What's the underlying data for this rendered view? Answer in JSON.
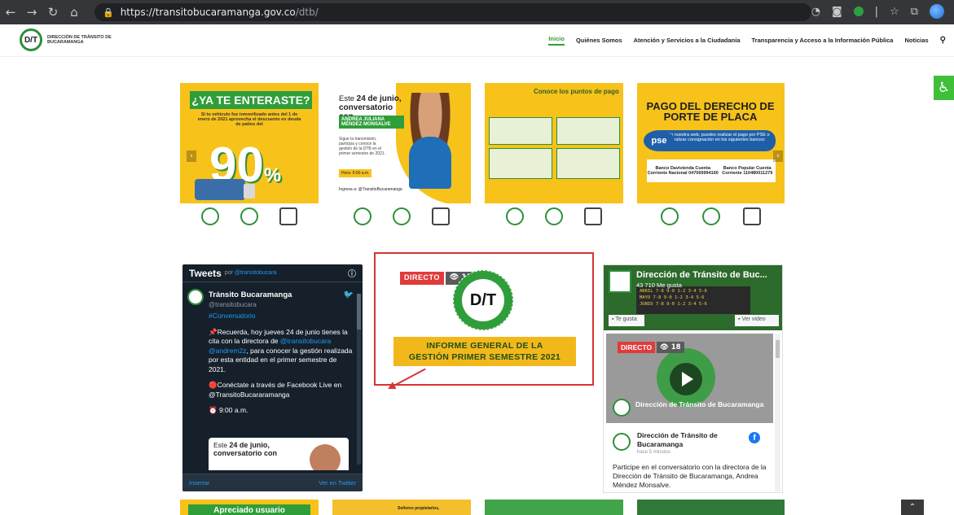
{
  "browser": {
    "url_host": "https://transitobucaramanga.gov.co",
    "url_path": "/dtb/"
  },
  "site": {
    "logo_text": "DIRECCIÓN DE TRÁNSITO DE BUCARAMANGA",
    "logo_mark": "D/T",
    "menu": [
      {
        "label": "Inicio",
        "active": true
      },
      {
        "label": "Quiénes Somos"
      },
      {
        "label": "Atención y Servicios a la Ciudadanía"
      },
      {
        "label": "Transparencia y Acceso a la Información Pública"
      },
      {
        "label": "Noticias"
      }
    ]
  },
  "carousel": {
    "card1": {
      "title": "¿YA TE ENTERASTE?",
      "subtitle": "Si tu vehículo fue inmovilizado antes del 1 de enero de 2021 aprovecha el descuento en deuda de patios del",
      "percent": "90",
      "percent_sign": "%"
    },
    "card2": {
      "intro": "Este",
      "date": "24 de junio,",
      "headline": "conversatorio con",
      "name": "ANDREA JULIANA MÉNDEZ MONSALVE",
      "small": "Sigue la transmisión, participa y conoce la gestión de la DTB en el primer semestre de 2021.",
      "hora": "Hora: 9:00 a.m.",
      "fb": "Ingresa a: @TransitoBucaramanga"
    },
    "card3": {
      "title": "Conoce los puntos de pago"
    },
    "card4": {
      "title": "PAGO DEL DERECHO DE PORTE DE PLACA",
      "pse": "pse",
      "pse_text": "En nuestra web, puedes realizar el pago por PSE o realizar consignación en los siguientes bancos:",
      "bank1": "Banco Davivienda Cuenta Corriente Nacional 047069994160",
      "bank2": "Banco Popular Cuenta Corriente 110480011279"
    }
  },
  "twitter": {
    "header": "Tweets",
    "by": "por",
    "handle": "@transitobucara",
    "account_name": "Tránsito Bucaramanga",
    "account_handle": "@transitobucara",
    "hashtag": "#Conversatorio",
    "p1_a": "📌Recuerda, hoy jueves 24 de junio tienes la cita con la directora de ",
    "p1_link1": "@transitobucara",
    "p1_link2": "@andrem2z",
    "p1_b": ", para conocer la gestión realizada por esta entidad en el primer semestre de 2021.",
    "p2": "🔴Conéctate a través de Facebook Live en @TransitoBucararamanga",
    "p3": "⏰ 9:00 a.m.",
    "embed_a": "Este",
    "embed_b": "24 de junio,",
    "embed_c": "conversatorio con",
    "insert": "Insertar",
    "view": "Ver en Twitter"
  },
  "feature": {
    "live": "DIRECTO",
    "views": "👁 18",
    "logo": "D/T",
    "banner_line1": "INFORME GENERAL DE LA",
    "banner_line2": "GESTIÓN PRIMER SEMESTRE 2021"
  },
  "facebook": {
    "page_name": "Dirección de Tránsito de Buc...",
    "likes": "43 710 Me gusta",
    "strip": "ABRIL 7-8 9-0 1-2 3-4 5-6\nMAYO 7-8 9-0 1-2 3-4 5-6\nJUNIO 7-8 9-0 1-2 3-4 5-6",
    "like_btn": "Te gusta",
    "video_btn": "Ver video",
    "live": "DIRECTO",
    "views": "👁 18",
    "video_title": "Dirección de Tránsito de Bucaramanga",
    "post_name": "Dirección de Tránsito de Bucaramanga",
    "post_time": "hace 5 minutos",
    "post_msg": "Participe en el conversatorio con la directora de la Dirección de Tránsito de Bucaramanga, Andrea Méndez Monsalve."
  },
  "bottom": {
    "b1": "Apreciado usuario",
    "b2": "Señores propietarios,"
  },
  "colors": {
    "brand_green": "#2f9e3a",
    "brand_yellow": "#f7c21a",
    "highlight_red": "#d63434"
  }
}
